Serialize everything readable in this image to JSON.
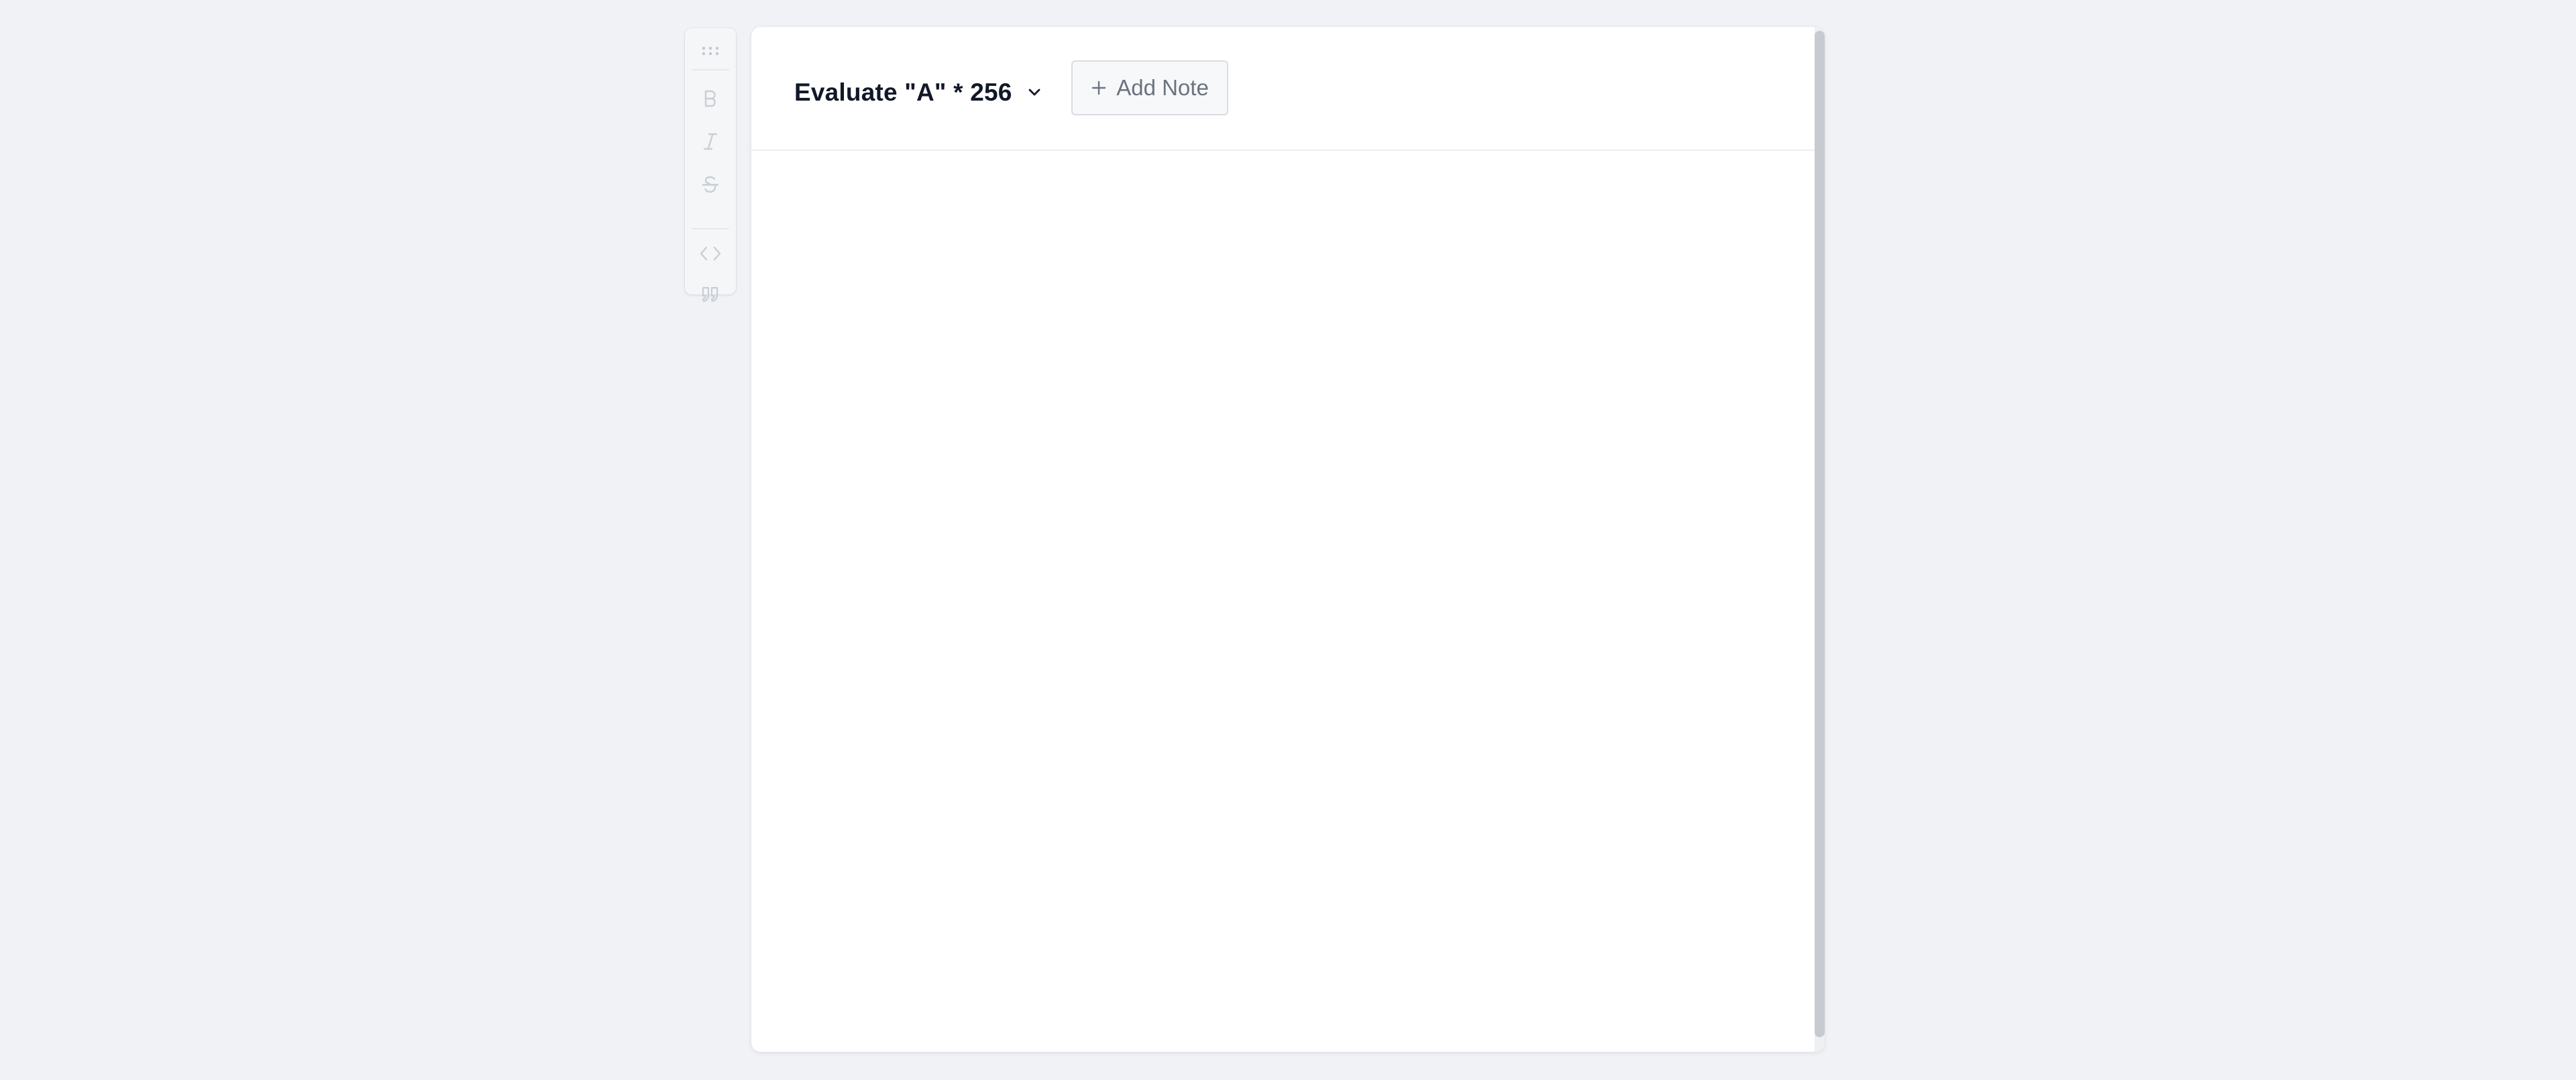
{
  "toolbar": {
    "items": [
      {
        "name": "drag-handle",
        "icon": "grip-dots-icon"
      },
      {
        "name": "bold",
        "icon": "bold-icon"
      },
      {
        "name": "italic",
        "icon": "italic-icon"
      },
      {
        "name": "strikethrough",
        "icon": "strikethrough-icon"
      },
      {
        "name": "code",
        "icon": "code-icon"
      },
      {
        "name": "quote",
        "icon": "quote-icon"
      }
    ],
    "icon_color": "#c9ced6"
  },
  "card": {
    "title": "Evaluate \"A\" * 256",
    "title_icon": "chevron-down-icon",
    "add_note_label": "Add Note",
    "add_note_icon": "plus-icon"
  },
  "colors": {
    "page_background": "#f0f2f5",
    "card_background": "#ffffff",
    "title_text": "#111827",
    "muted_text": "#6b7280",
    "border": "#d9dde2"
  }
}
